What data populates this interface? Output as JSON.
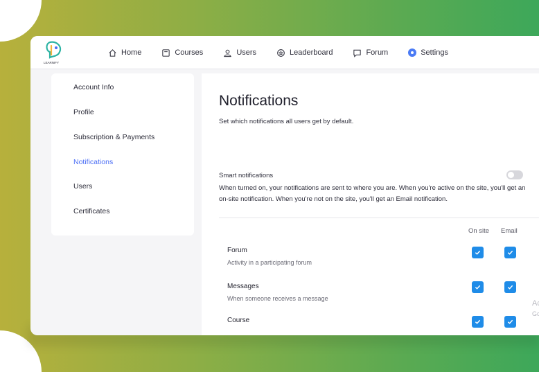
{
  "colors": {
    "accent": "#4b6ef5",
    "checkbox": "#1f8ce8",
    "background_gradient_start": "#b7b03c",
    "background_gradient_end": "#3da85a"
  },
  "logo": {
    "text": "LEARNIFY",
    "icon": "learnify-logo-icon"
  },
  "nav": {
    "items": [
      {
        "label": "Home",
        "icon": "home-icon"
      },
      {
        "label": "Courses",
        "icon": "courses-icon"
      },
      {
        "label": "Users",
        "icon": "users-icon"
      },
      {
        "label": "Leaderboard",
        "icon": "leaderboard-icon"
      },
      {
        "label": "Forum",
        "icon": "forum-icon"
      },
      {
        "label": "Settings",
        "icon": "settings-icon",
        "active": true
      }
    ]
  },
  "sidebar": {
    "items": [
      {
        "label": "Account Info"
      },
      {
        "label": "Profile"
      },
      {
        "label": "Subscription & Payments"
      },
      {
        "label": "Notifications",
        "active": true
      },
      {
        "label": "Users"
      },
      {
        "label": "Certificates"
      }
    ]
  },
  "main": {
    "title": "Notifications",
    "subtitle": "Set which notifications all users get by default.",
    "smart": {
      "label": "Smart notifications",
      "description": "When turned on, your notifications are sent to where you are. When you're active on the site, you'll get an on-site notification. When you're not on the site, you'll get an Email notification.",
      "enabled": false
    },
    "columns": {
      "onsite": "On site",
      "email": "Email"
    },
    "rows": [
      {
        "title": "Forum",
        "description": "Activity in a participating forum",
        "onsite": true,
        "email": true
      },
      {
        "title": "Messages",
        "description": "When someone receives a message",
        "onsite": true,
        "email": true
      },
      {
        "title": "Course",
        "description": "",
        "onsite": true,
        "email": true
      }
    ]
  },
  "watermark": {
    "line1": "Ac",
    "line2": "Go"
  }
}
